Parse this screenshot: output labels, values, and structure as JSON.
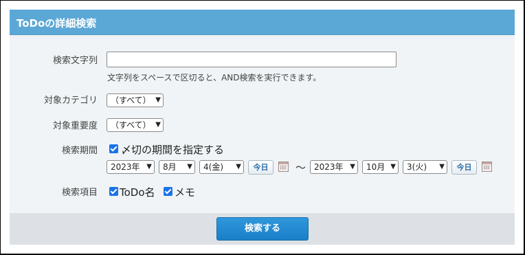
{
  "header": {
    "title": "ToDoの詳細検索"
  },
  "keyword": {
    "label": "検索文字列",
    "value": "",
    "hint": "文字列をスペースで区切ると、AND検索を実行できます。"
  },
  "category": {
    "label": "対象カテゴリ",
    "selected": "（すべて）"
  },
  "priority": {
    "label": "対象重要度",
    "selected": "（すべて）"
  },
  "period": {
    "label": "検索期間",
    "deadline_checkbox_label": "〆切の期間を指定する",
    "deadline_checked": true,
    "from": {
      "year": "2023年",
      "month": "8月",
      "day": "4(金)"
    },
    "to": {
      "year": "2023年",
      "month": "10月",
      "day": "3(火)"
    },
    "today_label": "今日",
    "separator": "〜"
  },
  "fields": {
    "label": "検索項目",
    "items": [
      {
        "label": "ToDo名",
        "checked": true
      },
      {
        "label": "メモ",
        "checked": true
      }
    ]
  },
  "footer": {
    "search_label": "検索する"
  },
  "colors": {
    "header_bg": "#5ba7d6",
    "form_bg": "#f0f4f6",
    "footer_bg": "#dde1e5",
    "primary_button": "#1a7fc8",
    "checkbox": "#1a73e8"
  }
}
